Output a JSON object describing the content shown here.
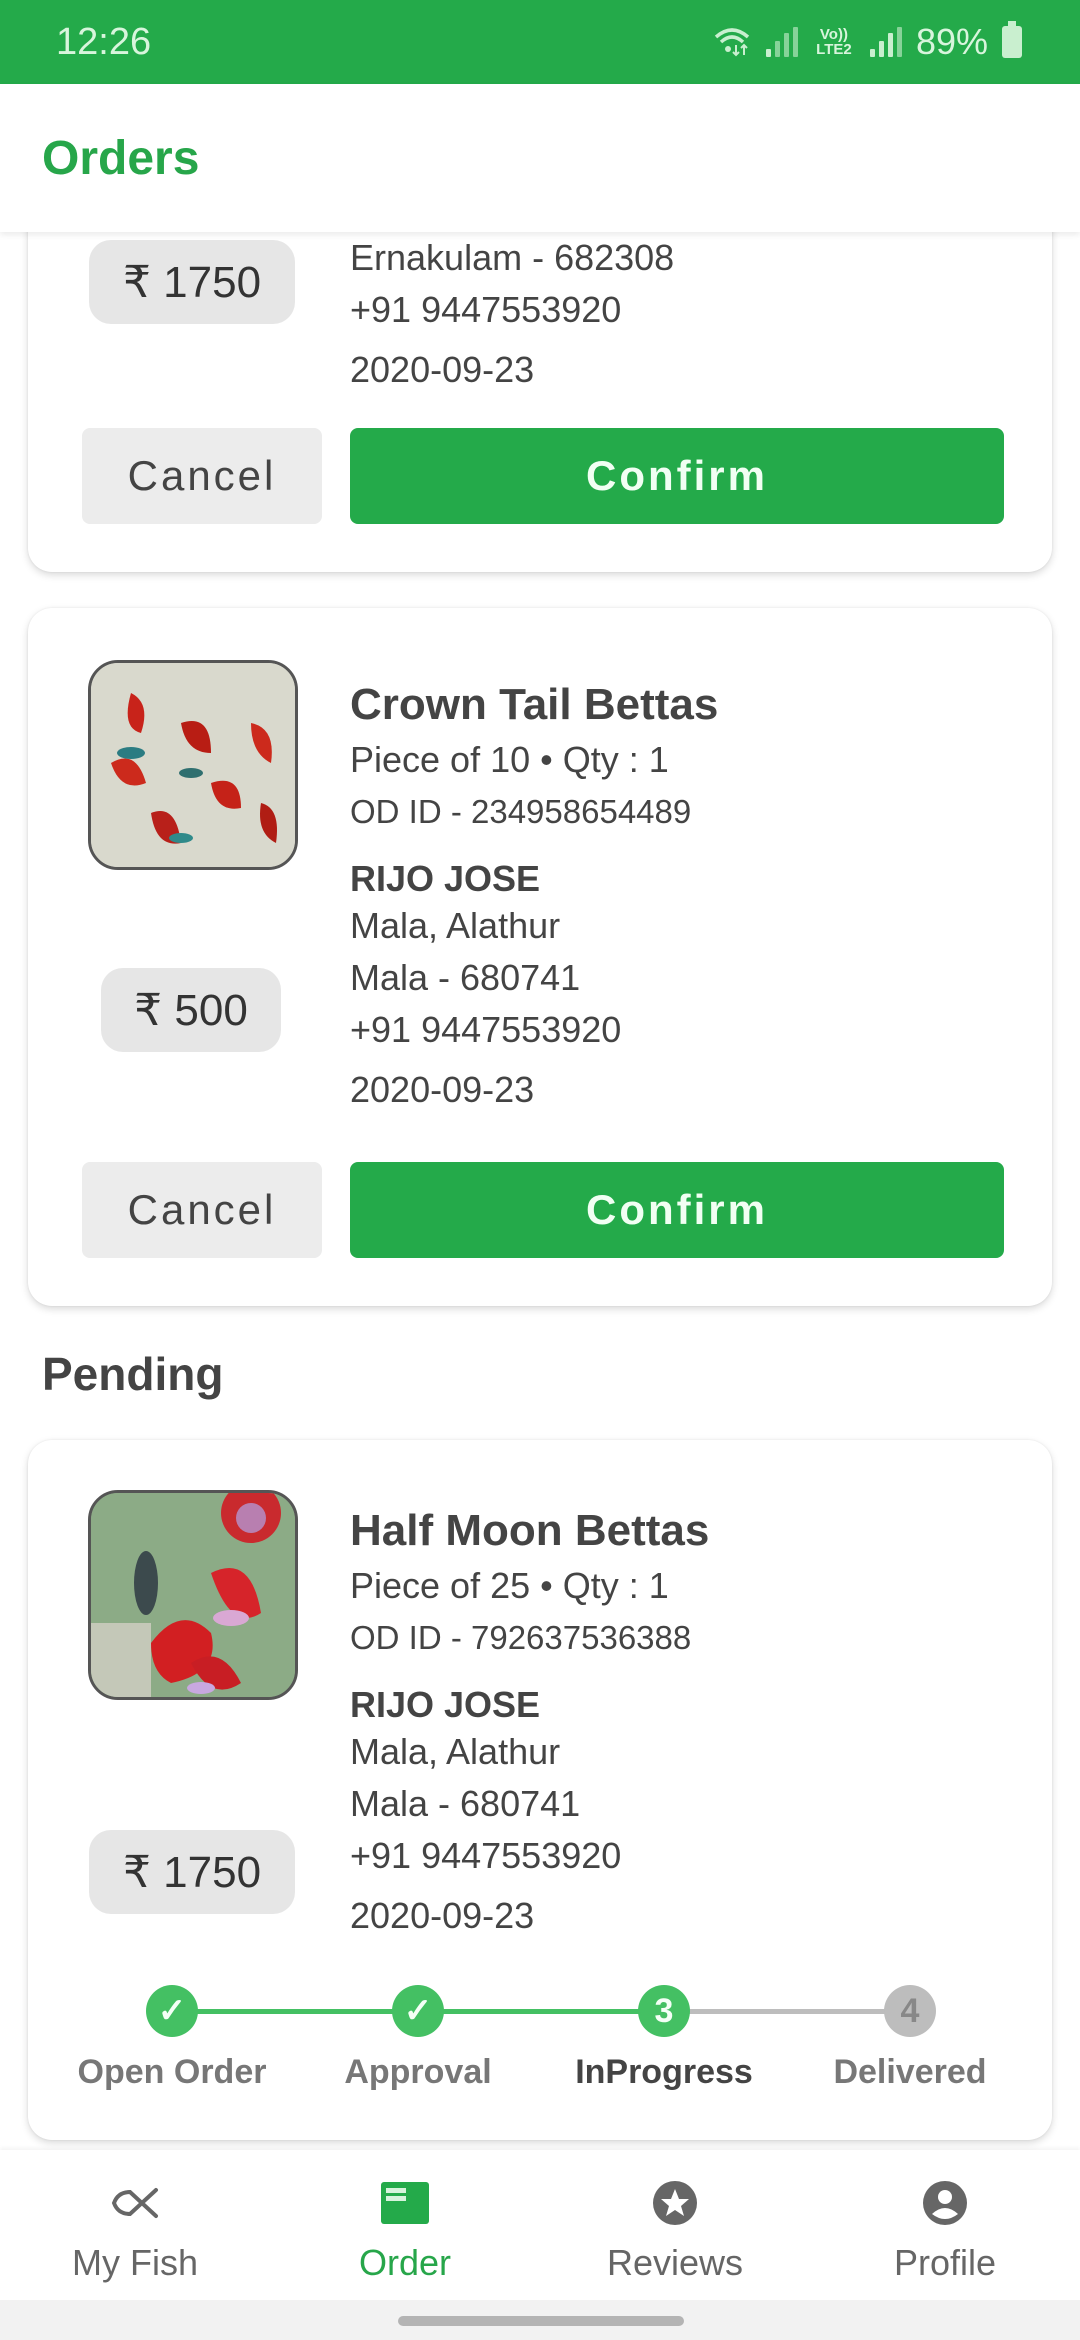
{
  "status_bar": {
    "time": "12:26",
    "network": "Vo)) LTE2",
    "battery": "89%"
  },
  "header": {
    "title": "Orders"
  },
  "colors": {
    "accent": "#24aa4a",
    "step_done": "#44c063",
    "step_pending": "#bdbdbd"
  },
  "orders_top": [
    {
      "price": "₹ 1750",
      "address_city": "Ernakulam - 682308",
      "phone": "+91 9447553920",
      "date": "2020-09-23",
      "cancel_label": "Cancel",
      "confirm_label": "Confirm"
    },
    {
      "title": "Crown Tail Bettas",
      "pieces": "Piece of 10",
      "qty": "Qty : 1",
      "od_id": "OD ID - 234958654489",
      "customer": "RIJO JOSE",
      "address_line": "Mala, Alathur",
      "address_city": "Mala - 680741",
      "phone": "+91 9447553920",
      "date": "2020-09-23",
      "price": "₹ 500",
      "cancel_label": "Cancel",
      "confirm_label": "Confirm",
      "image_icon": "betta-fish-photo"
    }
  ],
  "pending_section": {
    "title": "Pending",
    "order": {
      "title": "Half Moon Bettas",
      "pieces": "Piece of 25",
      "qty": "Qty : 1",
      "od_id": "OD ID - 792637536388",
      "customer": "RIJO JOSE",
      "address_line": "Mala, Alathur",
      "address_city": "Mala - 680741",
      "phone": "+91 9447553920",
      "date": "2020-09-23",
      "price": "₹ 1750",
      "image_icon": "betta-fish-photo",
      "steps": [
        {
          "label": "Open Order",
          "state": "done",
          "marker": "✓"
        },
        {
          "label": "Approval",
          "state": "done",
          "marker": "✓"
        },
        {
          "label": "InProgress",
          "state": "current",
          "marker": "3"
        },
        {
          "label": "Delivered",
          "state": "pending",
          "marker": "4"
        }
      ]
    }
  },
  "bottom_nav": [
    {
      "label": "My Fish",
      "icon": "fish-icon",
      "active": false
    },
    {
      "label": "Order",
      "icon": "order-icon",
      "active": true
    },
    {
      "label": "Reviews",
      "icon": "star-icon",
      "active": false
    },
    {
      "label": "Profile",
      "icon": "profile-icon",
      "active": false
    }
  ]
}
